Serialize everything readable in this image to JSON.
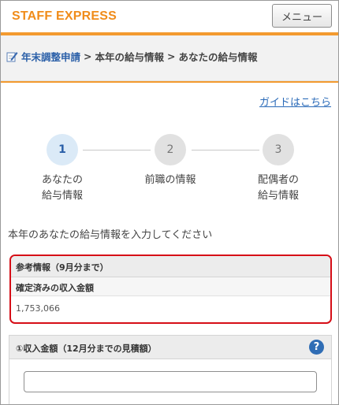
{
  "header": {
    "logo": "STAFF EXPRESS",
    "menu_label": "メニュー"
  },
  "breadcrumb": {
    "icon": "edit-icon",
    "link": "年末調整申請",
    "sep1": ">",
    "item2": "本年の給与情報",
    "sep2": ">",
    "item3": "あなたの給与情報"
  },
  "guide_link": "ガイドはこちら",
  "stepper": {
    "steps": [
      {
        "number": "1",
        "line1": "あなたの",
        "line2": "給与情報",
        "state": "active"
      },
      {
        "number": "2",
        "line1": "前職の情報",
        "line2": "",
        "state": "inactive"
      },
      {
        "number": "3",
        "line1": "配偶者の",
        "line2": "給与情報",
        "state": "inactive"
      }
    ]
  },
  "intro_text": "本年のあなたの給与情報を入力してください",
  "reference": {
    "heading": "参考情報（9月分まで）",
    "subheading": "確定済みの収入金額",
    "value": "1,753,066"
  },
  "income": {
    "heading": "①収入金額（12月分までの見積額）",
    "help_icon": "help-icon",
    "input_value": "",
    "input_placeholder": ""
  },
  "colors": {
    "brand_orange": "#f08c1a",
    "accent_blue": "#2a5fa8",
    "highlight_red": "#d60e17"
  }
}
